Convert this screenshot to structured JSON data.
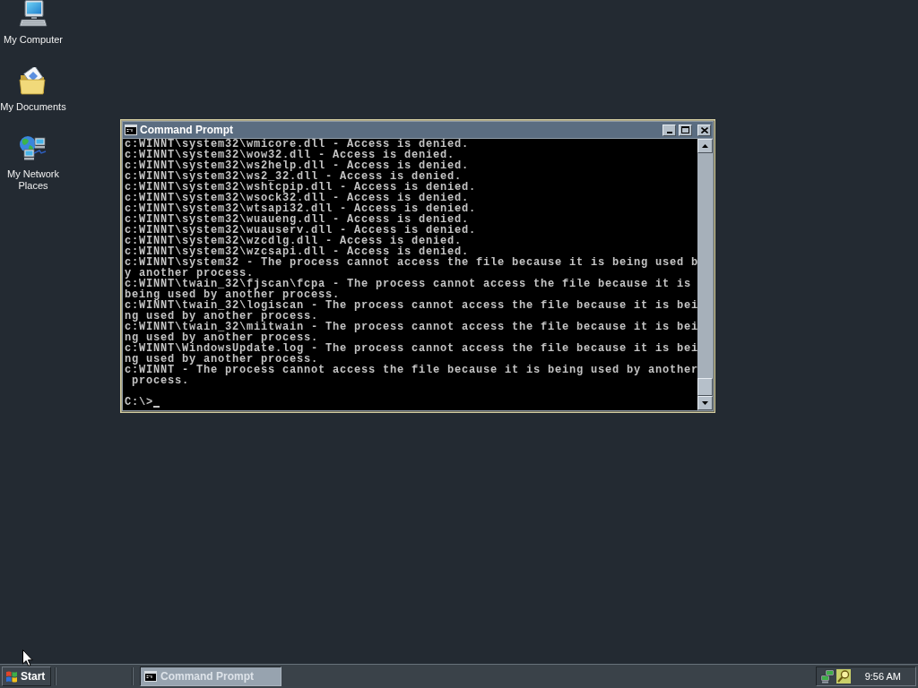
{
  "desktop": {
    "icons": [
      {
        "kind": "computer",
        "label": "My Computer"
      },
      {
        "kind": "documents",
        "label": "My Documents"
      },
      {
        "kind": "network",
        "label": "My Network Places"
      }
    ]
  },
  "console_window": {
    "title": "Command Prompt",
    "lines": [
      "c:WINNT\\system32\\wmicore.dll - Access is denied.",
      "c:WINNT\\system32\\wow32.dll - Access is denied.",
      "c:WINNT\\system32\\ws2help.dll - Access is denied.",
      "c:WINNT\\system32\\ws2_32.dll - Access is denied.",
      "c:WINNT\\system32\\wshtcpip.dll - Access is denied.",
      "c:WINNT\\system32\\wsock32.dll - Access is denied.",
      "c:WINNT\\system32\\wtsapi32.dll - Access is denied.",
      "c:WINNT\\system32\\wuaueng.dll - Access is denied.",
      "c:WINNT\\system32\\wuauserv.dll - Access is denied.",
      "c:WINNT\\system32\\wzcdlg.dll - Access is denied.",
      "c:WINNT\\system32\\wzcsapi.dll - Access is denied.",
      "c:WINNT\\system32 - The process cannot access the file because it is being used b",
      "y another process.",
      "c:WINNT\\twain_32\\fjscan\\fcpa - The process cannot access the file because it is",
      "being used by another process.",
      "c:WINNT\\twain_32\\logiscan - The process cannot access the file because it is bei",
      "ng used by another process.",
      "c:WINNT\\twain_32\\miitwain - The process cannot access the file because it is bei",
      "ng used by another process.",
      "c:WINNT\\WindowsUpdate.log - The process cannot access the file because it is bei",
      "ng used by another process.",
      "c:WINNT - The process cannot access the file because it is being used by another",
      " process."
    ],
    "prompt": "C:\\>"
  },
  "taskbar": {
    "start": "Start",
    "tasks": [
      {
        "label": "Command Prompt",
        "selected": true
      }
    ],
    "clock": "9:56 AM"
  }
}
